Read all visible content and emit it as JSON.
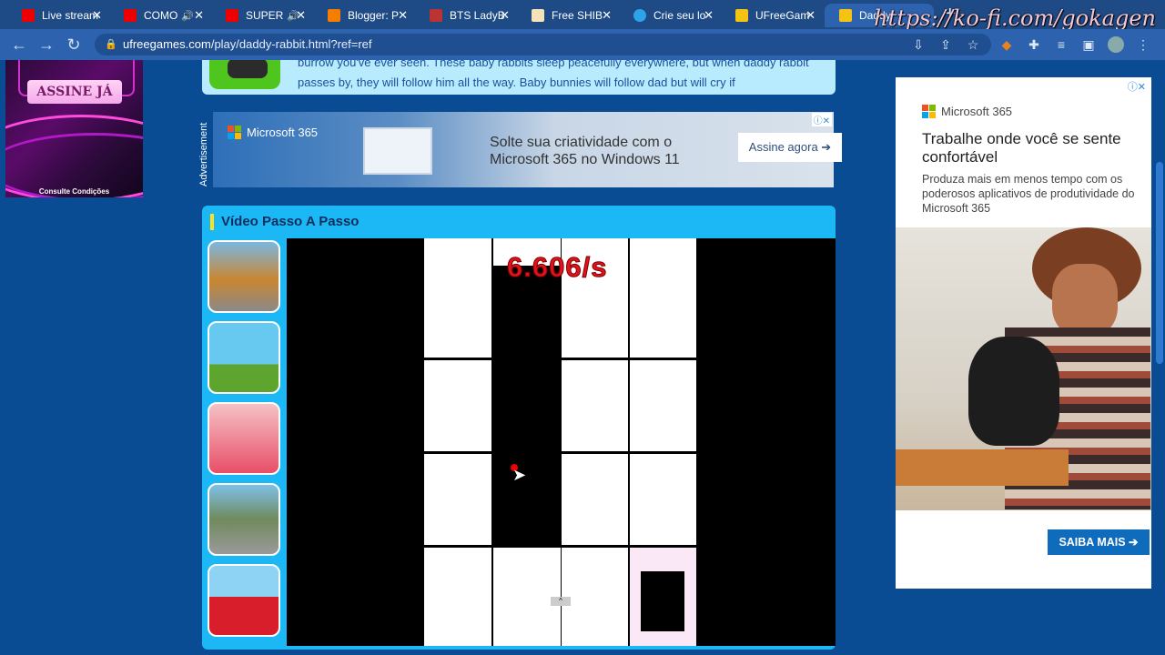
{
  "browser": {
    "tabs": [
      {
        "label": "Live stream",
        "icon": "youtube-icon",
        "audio": false,
        "active": false
      },
      {
        "label": "COMO",
        "icon": "youtube-icon",
        "audio": true,
        "active": false
      },
      {
        "label": "SUPER",
        "icon": "youtube-icon",
        "audio": true,
        "active": false
      },
      {
        "label": "Blogger: P",
        "icon": "blogger-icon",
        "audio": false,
        "active": false
      },
      {
        "label": "BTS LadyB",
        "icon": "ladybug-icon",
        "audio": false,
        "active": false
      },
      {
        "label": "Free SHIB",
        "icon": "page-icon",
        "audio": false,
        "active": false
      },
      {
        "label": "Crie seu lo",
        "icon": "canva-icon",
        "audio": false,
        "active": false
      },
      {
        "label": "UFreeGam",
        "icon": "ufreegames-icon",
        "audio": false,
        "active": false
      },
      {
        "label": "Daddy",
        "icon": "ufreegames-icon",
        "audio": false,
        "active": true
      }
    ],
    "url_domain": "ufreegames.com",
    "url_path": "/play/daddy-rabbit.html?ref=ref",
    "watermark": "https://ko-fi.com/gokagen"
  },
  "left_ad": {
    "button": "ASSINE JÁ",
    "fine_print": "Consulte Condições"
  },
  "description": {
    "text": "burrow you've ever seen. These baby rabbits sleep peacefully everywhere, but when daddy rabbit passes by, they will follow him all the way. Baby bunnies will follow dad but will cry if"
  },
  "banner_ad": {
    "side_label": "Advertisement",
    "brand": "Microsoft 365",
    "headline": "Solte sua criatividade com o Microsoft 365 no Windows 11",
    "cta": "Assine agora ➔"
  },
  "video_panel": {
    "title": "Vídeo Passo A Passo",
    "timer": "6.606/s",
    "thumbnails": [
      "car-game-thumb",
      "platformer-game-thumb",
      "runner-game-thumb",
      "racing-game-thumb",
      "christmas-girl-game-thumb"
    ]
  },
  "right_ad": {
    "brand": "Microsoft 365",
    "headline": "Trabalhe onde você se sente confortável",
    "body": "Produza mais em menos tempo com os poderosos aplicativos de produtividade do Microsoft 365",
    "cta": "SAIBA MAIS ➔"
  },
  "colors": {
    "page_bg": "#0a4c93",
    "panel_bg": "#1cb7f5",
    "timer": "#e0121c",
    "cta_blue": "#0f6cbd"
  }
}
